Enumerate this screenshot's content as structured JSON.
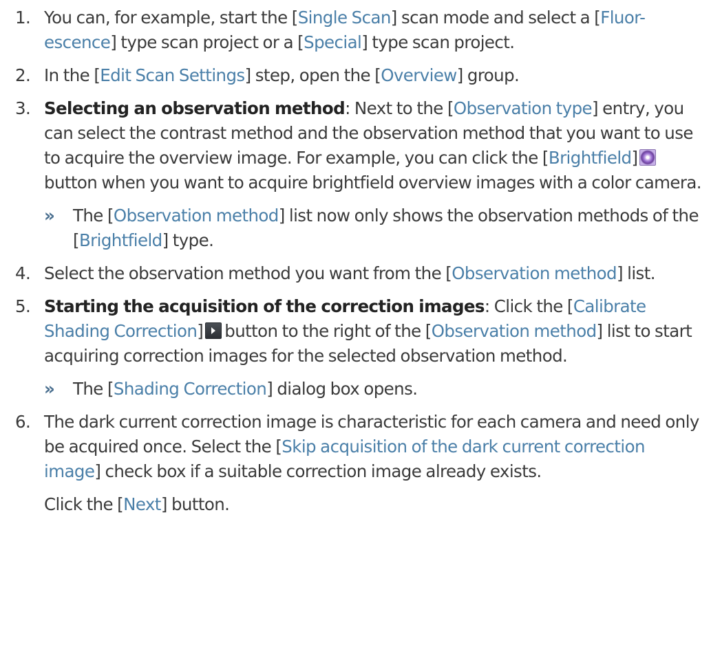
{
  "steps": [
    {
      "num": "1.",
      "t1": "You can, for example, start the [",
      "l1": "Single Scan",
      "t2": "] scan mode and select a [",
      "l2": "Fluor-escence",
      "t3": "] type scan project or a [",
      "l3": "Special",
      "t4": "] type scan project."
    },
    {
      "num": "2.",
      "t1": "In the [",
      "l1": "Edit Scan Settings",
      "t2": "] step, open the [",
      "l2": "Overview",
      "t3": "] group."
    },
    {
      "num": "3.",
      "bold": "Selecting an observation method",
      "t1": ": Next to the [",
      "l1": "Observation type",
      "t2": "] entry, you can select the contrast method and the observation method that you want to use to acquire the overview image. For example, you can click the [",
      "l2": "Brightfield",
      "t3": "]",
      "icon": "brightfield-icon",
      "t4": "button when you want to acquire brightfield overview images with a color camera.",
      "result": {
        "marker": "»",
        "t1": "The [",
        "l1": "Observation method",
        "t2": "] list now only shows the observation methods of the [",
        "l2": "Brightfield",
        "t3": "] type."
      }
    },
    {
      "num": "4.",
      "t1": "Select the observation method you want from the [",
      "l1": "Observation method",
      "t2": "] list."
    },
    {
      "num": "5.",
      "bold": "Starting the acquisition of the correction images",
      "t1": ": Click the [",
      "l1": "Calibrate Shading Correction",
      "t2": "]",
      "icon": "calibrate-arrow-icon",
      "t3": "button to the right of the [",
      "l2": "Observation method",
      "t4": "] list to start acquiring correction images for the selected observation method.",
      "result": {
        "marker": "»",
        "t1": "The [",
        "l1": "Shading Correction",
        "t2": "] dialog box opens."
      }
    },
    {
      "num": "6.",
      "t1": "The dark current correction image is characteristic for each camera and need only be acquired once. Select the [",
      "l1": "Skip acquisition of the dark current correction image",
      "t2": "] check box if a suitable correction image already exists.",
      "cont": {
        "t1": "Click the [",
        "l1": "Next",
        "t2": "] button."
      }
    }
  ]
}
